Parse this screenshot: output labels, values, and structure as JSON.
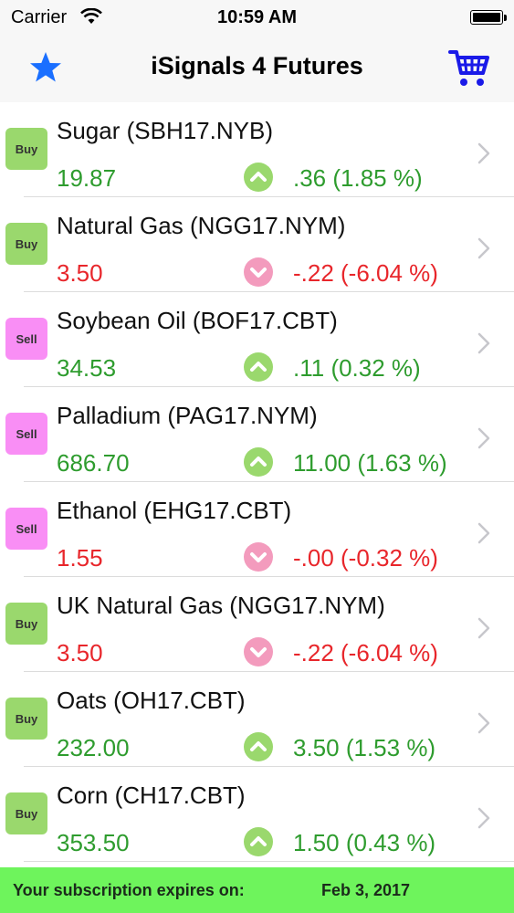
{
  "status_bar": {
    "carrier": "Carrier",
    "time": "10:59 AM",
    "icons": [
      "wifi-icon",
      "battery-icon"
    ]
  },
  "nav": {
    "title": "iSignals 4 Futures",
    "left_icon": "star-icon",
    "right_icon": "cart-icon",
    "accent_color": "#1a6fff"
  },
  "colors": {
    "buy": "#9ad86d",
    "sell": "#f98ef5",
    "up": "#2e9c2e",
    "down": "#e8262b",
    "footer": "#6ef45c"
  },
  "rows": [
    {
      "signal": "Buy",
      "name": "Sugar (SBH17.NYB)",
      "price": "19.87",
      "direction": "up",
      "change": ".36 (1.85 %)"
    },
    {
      "signal": "Buy",
      "name": "Natural Gas (NGG17.NYM)",
      "price": "3.50",
      "direction": "down",
      "change": "-.22 (-6.04 %)"
    },
    {
      "signal": "Sell",
      "name": "Soybean Oil (BOF17.CBT)",
      "price": "34.53",
      "direction": "up",
      "change": ".11 (0.32 %)"
    },
    {
      "signal": "Sell",
      "name": "Palladium (PAG17.NYM)",
      "price": "686.70",
      "direction": "up",
      "change": "11.00 (1.63 %)"
    },
    {
      "signal": "Sell",
      "name": "Ethanol (EHG17.CBT)",
      "price": "1.55",
      "direction": "down",
      "change": "-.00 (-0.32 %)"
    },
    {
      "signal": "Buy",
      "name": "UK Natural Gas (NGG17.NYM)",
      "price": "3.50",
      "direction": "down",
      "change": "-.22 (-6.04 %)"
    },
    {
      "signal": "Buy",
      "name": "Oats (OH17.CBT)",
      "price": "232.00",
      "direction": "up",
      "change": "3.50 (1.53 %)"
    },
    {
      "signal": "Buy",
      "name": "Corn (CH17.CBT)",
      "price": "353.50",
      "direction": "up",
      "change": "1.50 (0.43 %)"
    }
  ],
  "footer": {
    "label": "Your subscription expires on:",
    "date": "Feb 3, 2017"
  }
}
